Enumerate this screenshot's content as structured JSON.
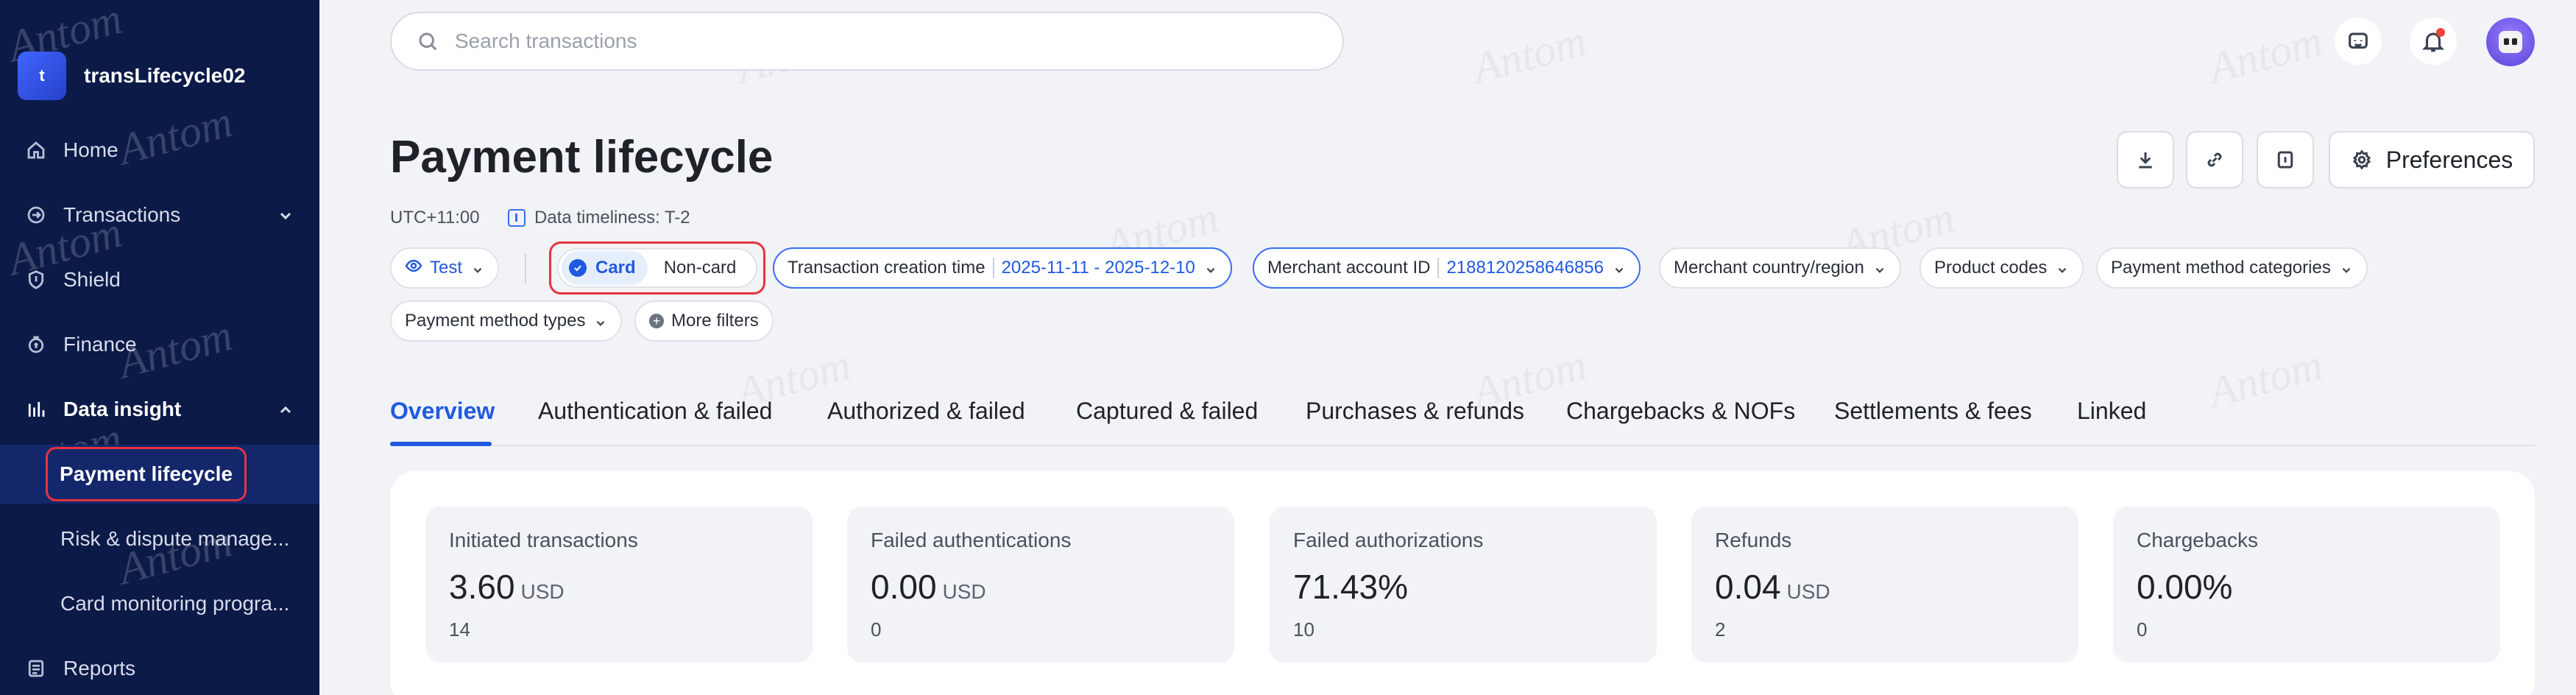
{
  "sidebar": {
    "brand": {
      "logo_letter": "t",
      "name": "transLifecycle02"
    },
    "items": [
      {
        "label": "Home",
        "icon": "home-icon"
      },
      {
        "label": "Transactions",
        "icon": "transactions-icon"
      },
      {
        "label": "Shield",
        "icon": "shield-icon"
      },
      {
        "label": "Finance",
        "icon": "finance-icon"
      },
      {
        "label": "Data insight",
        "icon": "data-insight-icon",
        "expanded": true
      },
      {
        "label": "Reports",
        "icon": "reports-icon"
      }
    ],
    "sub_items": [
      {
        "label": "Payment lifecycle",
        "selected": true
      },
      {
        "label": "Risk & dispute manage..."
      },
      {
        "label": "Card monitoring progra..."
      }
    ]
  },
  "search": {
    "placeholder": "Search transactions",
    "value": ""
  },
  "header": {
    "title": "Payment lifecycle",
    "timezone": "UTC+11:00",
    "timeliness": "Data timeliness: T-2",
    "preferences_label": "Preferences"
  },
  "filters": {
    "environment": "Test",
    "segment_on": "Card",
    "segment_off": "Non-card",
    "creation_time_label": "Transaction creation time",
    "creation_time_value": "2025-11-11 - 2025-12-10",
    "merchant_account_label": "Merchant account ID",
    "merchant_account_value": "2188120258646856",
    "merchant_country": "Merchant country/region",
    "product_codes": "Product codes",
    "pm_categories": "Payment method categories",
    "pm_types": "Payment method types",
    "more_filters": "More filters"
  },
  "tabs": [
    {
      "label": "Overview",
      "active": true
    },
    {
      "label": "Authentication & failed"
    },
    {
      "label": "Authorized & failed"
    },
    {
      "label": "Captured & failed"
    },
    {
      "label": "Purchases & refunds"
    },
    {
      "label": "Chargebacks & NOFs"
    },
    {
      "label": "Settlements & fees"
    },
    {
      "label": "Linked"
    }
  ],
  "metrics": [
    {
      "label": "Initiated transactions",
      "value": "3.60",
      "unit": "USD",
      "count": "14"
    },
    {
      "label": "Failed authentications",
      "value": "0.00",
      "unit": "USD",
      "count": "0"
    },
    {
      "label": "Failed authorizations",
      "value": "71.43%",
      "unit": "",
      "count": "10"
    },
    {
      "label": "Refunds",
      "value": "0.04",
      "unit": "USD",
      "count": "2"
    },
    {
      "label": "Chargebacks",
      "value": "0.00%",
      "unit": "",
      "count": "0"
    }
  ],
  "watermark": "Antom",
  "colors": {
    "sidebar_bg": "#0c1a48",
    "accent": "#2159e0",
    "highlight_border": "#e6343f",
    "page_bg": "#f1f3f7"
  }
}
